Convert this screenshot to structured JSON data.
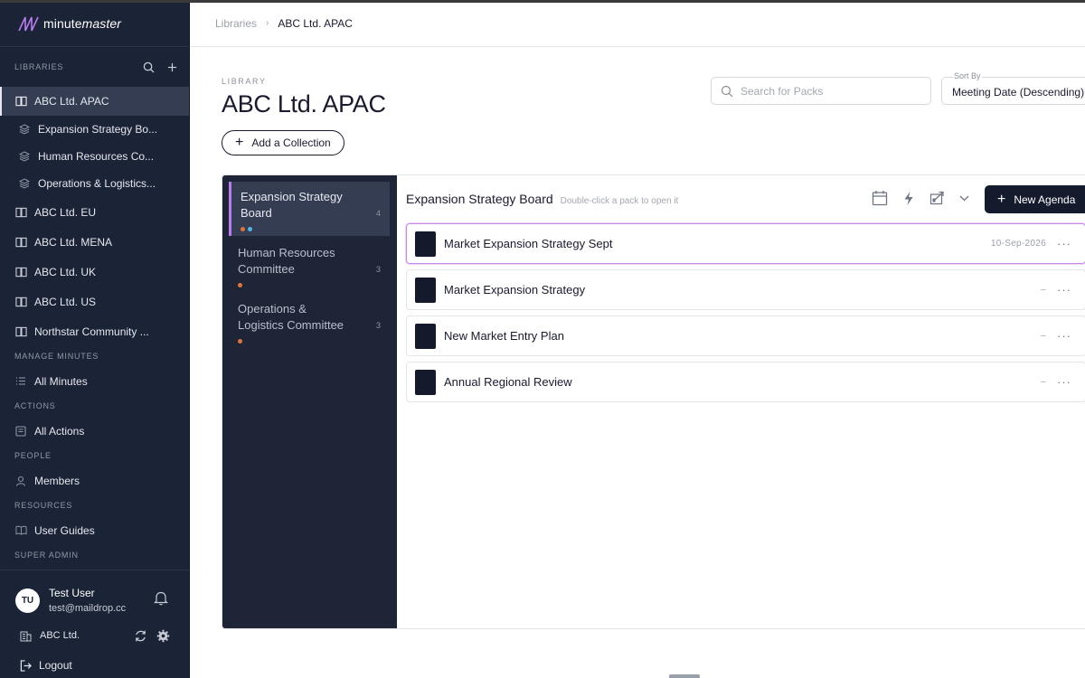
{
  "brand": {
    "name_regular": "minute",
    "name_italic": "master"
  },
  "sidebar": {
    "libraries_label": "LIBRARIES",
    "libraries": [
      {
        "label": "ABC Ltd. APAC",
        "active": true,
        "type": "library"
      },
      {
        "label": "Expansion Strategy Bo...",
        "type": "collection"
      },
      {
        "label": "Human Resources Co...",
        "type": "collection"
      },
      {
        "label": "Operations & Logistics...",
        "type": "collection"
      },
      {
        "label": "ABC Ltd. EU",
        "type": "library"
      },
      {
        "label": "ABC Ltd. MENA",
        "type": "library"
      },
      {
        "label": "ABC Ltd. UK",
        "type": "library"
      },
      {
        "label": "ABC Ltd. US",
        "type": "library"
      },
      {
        "label": "Northstar Community ...",
        "type": "library"
      }
    ],
    "manage_minutes_label": "MANAGE MINUTES",
    "all_minutes": "All Minutes",
    "actions_label": "ACTIONS",
    "all_actions": "All Actions",
    "people_label": "PEOPLE",
    "members": "Members",
    "resources_label": "RESOURCES",
    "user_guides": "User Guides",
    "super_admin_label": "SUPER ADMIN"
  },
  "user": {
    "initials": "TU",
    "name": "Test User",
    "email": "test@maildrop.cc",
    "org": "ABC Ltd.",
    "logout": "Logout"
  },
  "breadcrumb": {
    "root": "Libraries",
    "current": "ABC Ltd. APAC"
  },
  "page": {
    "kicker": "LIBRARY",
    "title": "ABC Ltd. APAC",
    "add_collection": "Add a Collection"
  },
  "search": {
    "placeholder": "Search for Packs"
  },
  "sort": {
    "label": "Sort By",
    "value": "Meeting Date (Descending)"
  },
  "collections": [
    {
      "name": "Expansion Strategy Board",
      "count": "4",
      "active": true,
      "dots": [
        "#e0733a",
        "#4fb7e6"
      ]
    },
    {
      "name": "Human Resources Committee",
      "count": "3",
      "dots": [
        "#e0733a"
      ]
    },
    {
      "name": "Operations & Logistics Committee",
      "count": "3",
      "dots": [
        "#e0733a"
      ]
    }
  ],
  "packs_panel": {
    "title": "Expansion Strategy Board",
    "hint": "Double-click a pack to open it",
    "new_agenda": "New Agenda"
  },
  "packs": [
    {
      "name": "Market Expansion Strategy Sept",
      "date": "10-Sep-2026",
      "selected": true
    },
    {
      "name": "Market Expansion Strategy",
      "date": "–"
    },
    {
      "name": "New Market Entry Plan",
      "date": "–"
    },
    {
      "name": "Annual Regional Review",
      "date": "–"
    }
  ],
  "colors": {
    "sidebar_bg": "#1b2336",
    "accent_purple": "#b77cf0",
    "primary_button": "#141b2d"
  }
}
